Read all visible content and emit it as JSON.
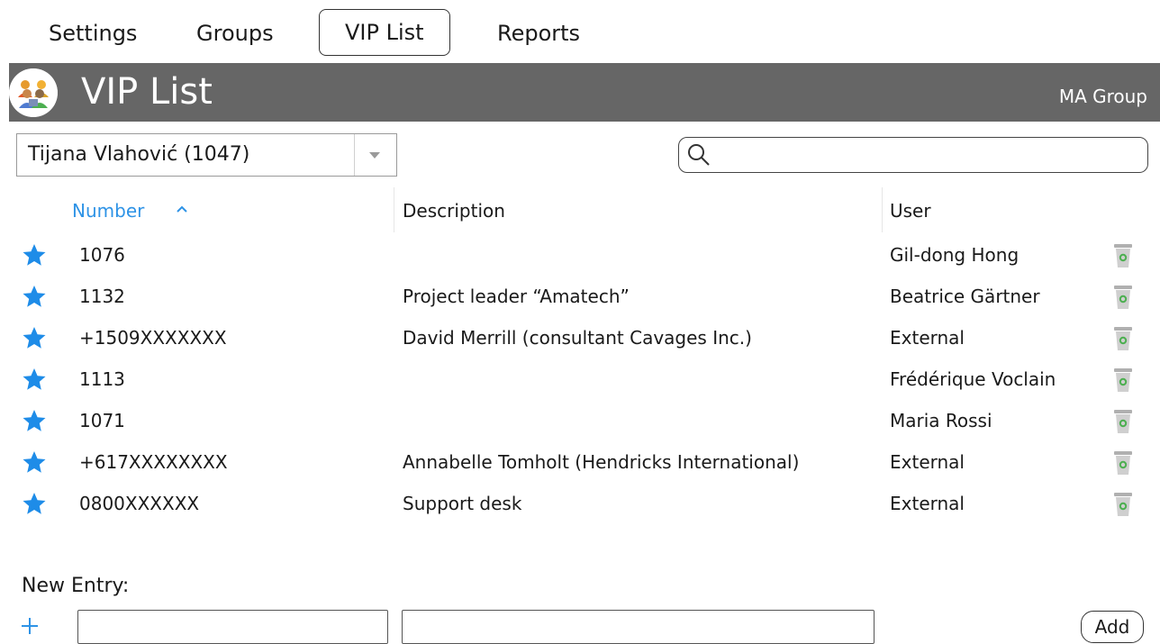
{
  "tabs": [
    {
      "label": "Settings",
      "active": false
    },
    {
      "label": "Groups",
      "active": false
    },
    {
      "label": "VIP List",
      "active": true
    },
    {
      "label": "Reports",
      "active": false
    }
  ],
  "header": {
    "title": "VIP List",
    "group": "MA Group",
    "icon": "people-group-icon",
    "bar_color": "#666666"
  },
  "user_select": {
    "value": "Tijana Vlahović (1047)"
  },
  "search": {
    "placeholder": "",
    "value": ""
  },
  "table": {
    "columns": [
      {
        "key": "number",
        "label": "Number",
        "sorted": "ascending"
      },
      {
        "key": "description",
        "label": "Description"
      },
      {
        "key": "user",
        "label": "User"
      }
    ],
    "rows": [
      {
        "number": "1076",
        "description": "",
        "user": "Gil-dong Hong"
      },
      {
        "number": "1132",
        "description": "Project leader “Amatech”",
        "user": "Beatrice Gärtner"
      },
      {
        "number": "+1509XXXXXXX",
        "description": "David Merrill (consultant Cavages Inc.)",
        "user": "External"
      },
      {
        "number": "1113",
        "description": "",
        "user": "Frédérique Voclain"
      },
      {
        "number": "1071",
        "description": "",
        "user": "Maria Rossi"
      },
      {
        "number": "+617XXXXXXXX",
        "description": "Annabelle Tomholt (Hendricks International)",
        "user": "External"
      },
      {
        "number": "0800XXXXXX",
        "description": "Support desk",
        "user": "External"
      }
    ]
  },
  "new_entry": {
    "label": "New Entry:",
    "number_value": "",
    "description_value": "",
    "add_label": "Add"
  },
  "colors": {
    "accent": "#2e93e6",
    "header_bg": "#666666",
    "trash_green": "#4caf50"
  }
}
